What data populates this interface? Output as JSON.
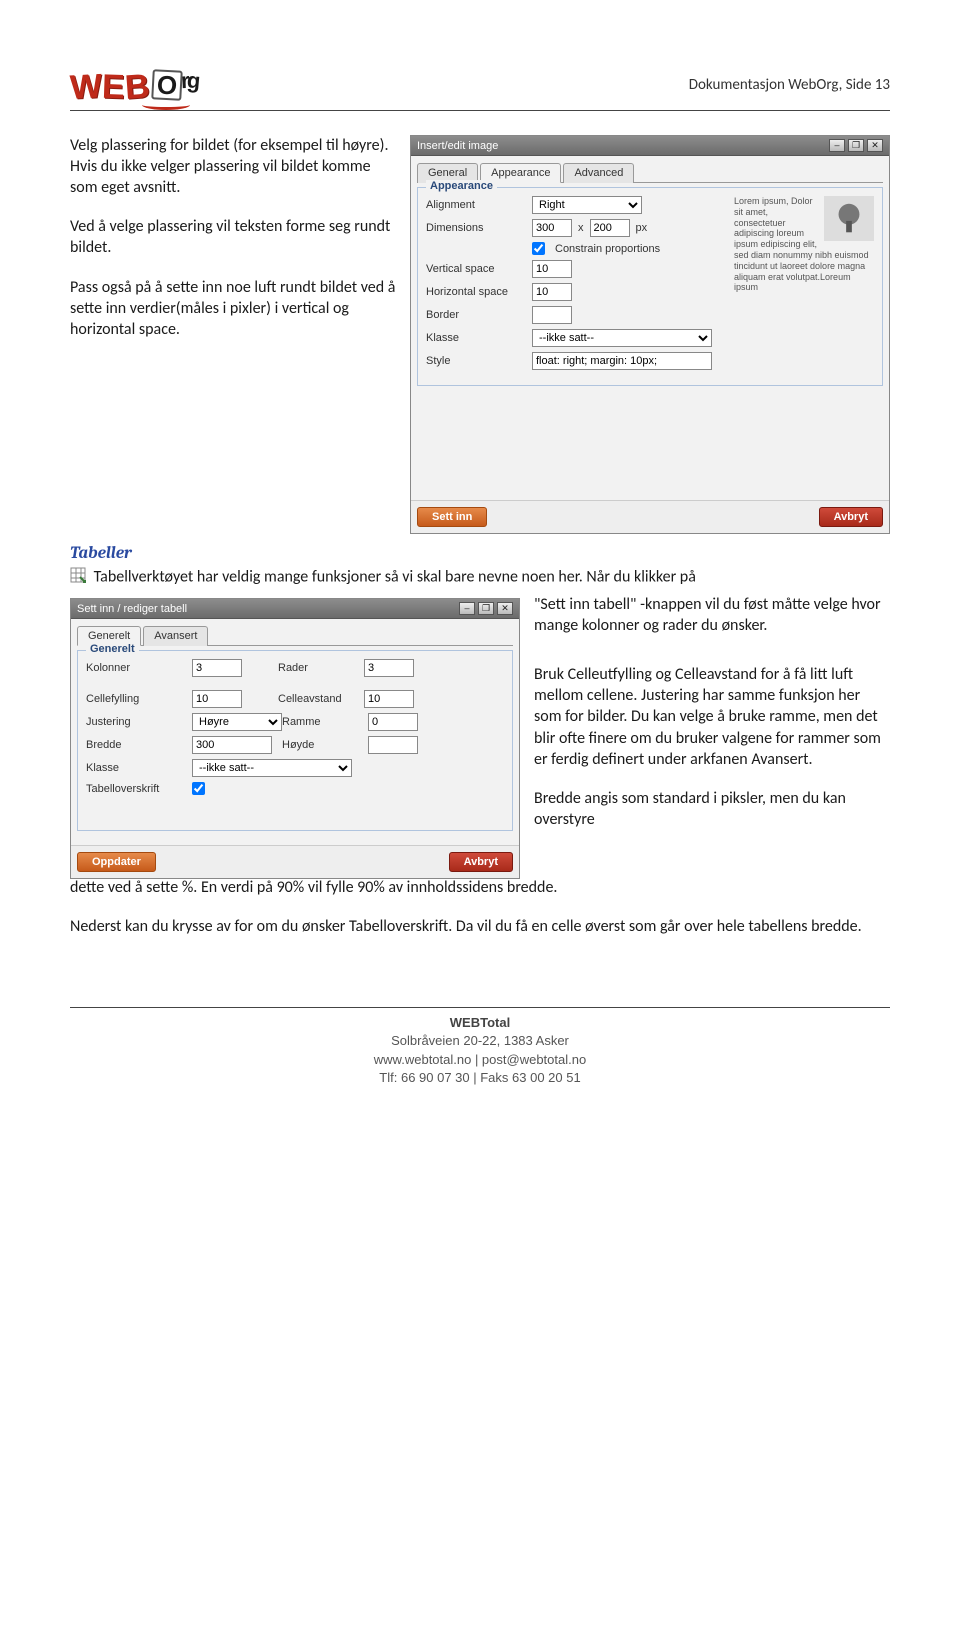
{
  "header": {
    "pagenum": "Dokumentasjon WebOrg, Side 13",
    "logo_parts": [
      "W",
      "E",
      "B",
      "O",
      "r",
      "g"
    ]
  },
  "para1": "Velg plassering for bildet (for eksempel til høyre). Hvis du ikke velger plassering vil bildet komme som eget avsnitt.",
  "para2": "Ved å velge plassering vil teksten forme seg rundt bildet.",
  "para3": "Pass også på å sette inn noe luft rundt bildet ved å sette inn verdier(måles i pixler) i vertical og horizontal space.",
  "dialog1": {
    "title": "Insert/edit image",
    "tabs": [
      "General",
      "Appearance",
      "Advanced"
    ],
    "legend": "Appearance",
    "rows": {
      "alignment_label": "Alignment",
      "alignment_value": "Right",
      "dimensions_label": "Dimensions",
      "dim_w": "300",
      "dim_x": "x",
      "dim_h": "200",
      "dim_px": "px",
      "constrain": "Constrain proportions",
      "vspace_label": "Vertical space",
      "vspace": "10",
      "hspace_label": "Horizontal space",
      "hspace": "10",
      "border_label": "Border",
      "border": "",
      "klasse_label": "Klasse",
      "klasse": "--ikke satt--",
      "style_label": "Style",
      "style": "float: right; margin: 10px;"
    },
    "preview": "Lorem ipsum, Dolor sit amet, consectetuer adipiscing loreum ipsum edipiscing elit, sed diam nonummy nibh euismod tincidunt ut laoreet dolore magna aliquam erat volutpat.Loreum ipsum",
    "btn_primary": "Sett inn",
    "btn_cancel": "Avbryt"
  },
  "tabeller_heading": "Tabeller",
  "tabeller_intro": "Tabellverktøyet har veldig mange funksjoner så vi skal bare nevne noen her. Når du klikker på",
  "tabeller_intro2": "\"Sett inn tabell\" -knappen vil du føst måtte velge hvor mange kolonner og rader du ønsker.",
  "dialog2": {
    "title": "Sett inn / rediger tabell",
    "tabs": [
      "Generelt",
      "Avansert"
    ],
    "legend": "Generelt",
    "kolonner_label": "Kolonner",
    "kolonner": "3",
    "rader_label": "Rader",
    "rader": "3",
    "cellefylling_label": "Cellefylling",
    "cellefylling": "10",
    "celleavstand_label": "Celleavstand",
    "celleavstand": "10",
    "justering_label": "Justering",
    "justering": "Høyre",
    "ramme_label": "Ramme",
    "ramme": "0",
    "bredde_label": "Bredde",
    "bredde": "300",
    "hoyde_label": "Høyde",
    "hoyde": "",
    "klasse_label": "Klasse",
    "klasse": "--ikke satt--",
    "tabelloverskrift_label": "Tabelloverskrift",
    "btn_primary": "Oppdater",
    "btn_cancel": "Avbryt"
  },
  "para_right1": "Bruk Celleutfylling og Celleavstand for å få litt luft mellom cellene. Justering har samme funksjon her som for bilder. Du kan velge å bruke ramme, men det blir ofte finere om du bruker valgene for rammer som er ferdig definert under arkfanen Avansert.",
  "para_right2_a": "Bredde angis som standard i piksler, men du kan overstyre",
  "para_right2_b": "dette ved å sette %. En verdi på 90% vil fylle 90% av innholdssidens bredde.",
  "para_last": "Nederst kan du krysse av for om du ønsker Tabelloverskrift. Da vil du få en celle øverst som går over hele tabellens bredde.",
  "footer": {
    "brand": "WEBTotal",
    "addr": "Solbråveien 20-22, 1383 Asker",
    "web": "www.webtotal.no | post@webtotal.no",
    "tel": "Tlf: 66 90 07 30 | Faks 63 00 20 51"
  }
}
